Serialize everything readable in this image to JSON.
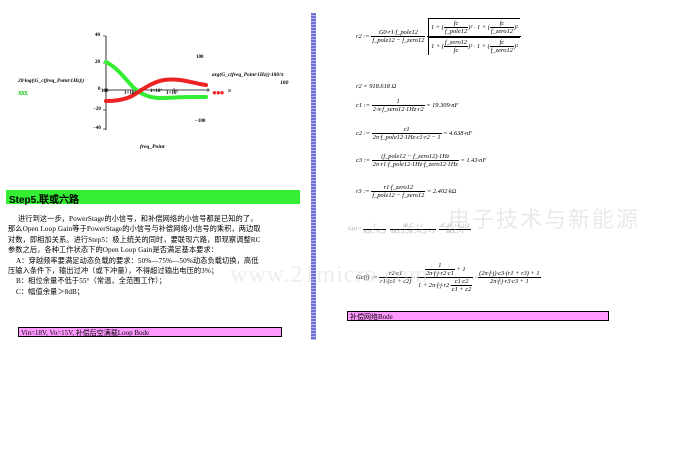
{
  "plot": {
    "ylabel": "20·log(|G_c(freq_Point·1Hz)|)",
    "y2label": "arg(G_c(freq_Point·1Hz))·180/π",
    "xlabel": "freq_Point",
    "yticks": [
      "40",
      "20",
      "0",
      "−20",
      "−40"
    ],
    "y2ticks": [
      "100",
      "−100"
    ],
    "xticks": [
      "100",
      "1×10³",
      "1×10⁴",
      "1×10⁵"
    ],
    "y2label_num": "180",
    "y2label_den": "π",
    "legend_green": "xxx",
    "legend_red": "●●●",
    "colors": {
      "gain": "#33ee33",
      "phase": "#ee2222"
    }
  },
  "section": {
    "title": "Step5.联或六路"
  },
  "paragraph": {
    "lines": [
      "进行到这一步，PowerStage的小信号，和补偿网络的小信号都是已知的了，",
      "那么Open Loop Gain等于PowerStage的小信号与补偿网络小信号的乘积，两边取",
      "对数，即相加关系。进行Step5：极上统关的同时，要联现六路，即现察调整RC",
      "参数之后，各种工作状态下的Open Loop Gain是否满足基本要求：",
      "A：穿越频率要满足动态负载的要求：50%—75%—50%动态负载切换，高低",
      "压输入条件下，输出过冲（或下冲量），不得超过输出电压的3%；",
      "B：相位余量不低于55°（常温，全范围工作）；",
      "C：幅值余量＞8dB；"
    ]
  },
  "caption_left": "Vin=18V, Vo=15V, 补偿后空满载Loop Bode",
  "caption_right": "补偿网络Bode",
  "watermark": {
    "cn": "电子技术与新能源",
    "url": "www.21micro.com"
  },
  "equations": {
    "r2_lhs": "r2 :=",
    "r2_num": "G0·r1·f_pole12",
    "r2_den": "f_pole12 − f_zero12",
    "r2_sqrt1_num": "fc",
    "r2_sqrt1_den": "f_pole12",
    "r2_sqrt2_num": "fc",
    "r2_sqrt2_den": "f_zero12",
    "r2_sqrt3_num": "f_zero12",
    "r2_sqrt3_den": "fc",
    "r2_sqrt4_num": "fc",
    "r2_sqrt4_den": "f_zero12",
    "r2_value": "r2 = 918.618 Ω",
    "c1_lhs": "c1 :=",
    "c1_num": "1",
    "c1_den": "2·π·f_zero12·1Hz·r2",
    "c1_value": "= 19.309·nF",
    "c2_lhs": "c2 :=",
    "c2_num": "c1",
    "c2_den": "2π·f_pole12·1Hz·c1·r2 − 1",
    "c2_value": "= 4.638·nF",
    "c3_lhs": "c3 :=",
    "c3_num": "(f_pole12 − f_zero12)·1Hz",
    "c3_den": "2π·r1·f_pole12·1Hz·f_zero12·1Hz",
    "c3_value": "= 1.43·nF",
    "r3_lhs": "r3 :=",
    "r3_num": "r1·f_zero12",
    "r3_den": "f_pole12 − f_zero12",
    "r3_value": "= 2.402·kΩ",
    "gs_lhs": "G(s) =",
    "gc_lhs": "Gc(f) :=",
    "gc_t1_num": "r2·c1",
    "gc_t1_den": "r1·(c1 + c2)",
    "gc_t2_num": "1",
    "gc_t2_sub": "2π·f·j·r2·c1",
    "gc_t2_plus": "+ 1",
    "gc_t2_den_a": "1 + 2π·f·j·r2·",
    "gc_t2_den_num": "c1·c2",
    "gc_t2_den_den": "c1 + c2",
    "gc_t3_num": "(2π·f·j)·c3·(r1 + r3) + 1",
    "gc_t3_den": "2π·f·j·r3·c3 + 1"
  }
}
